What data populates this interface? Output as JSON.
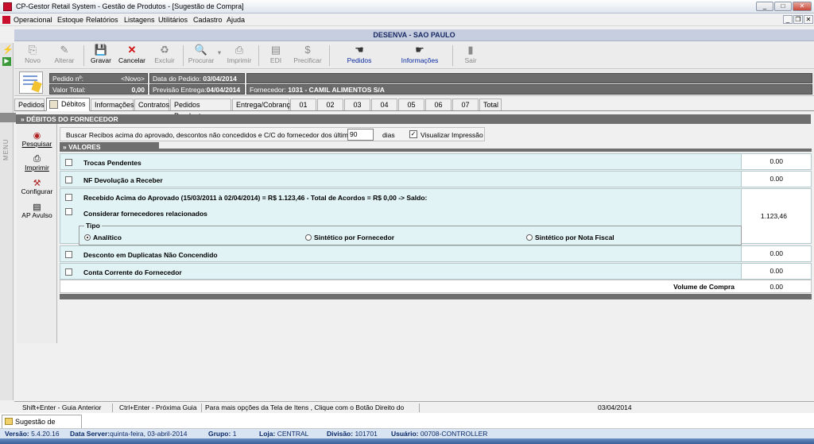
{
  "window": {
    "title": "CP-Gestor Retail System - Gestão de Produtos - [Sugestão de Compra]",
    "controls": {
      "minimize": "_",
      "maximize": "□",
      "close": "✕"
    },
    "mdi_controls": {
      "minimize": "_",
      "restore": "❐",
      "close": "✕"
    }
  },
  "menu": [
    "Operacional",
    "Estoque",
    "Relatórios",
    "Listagens",
    "Utilitários",
    "Cadastro",
    "Ajuda"
  ],
  "side": {
    "label": "MENU"
  },
  "branch": "DESENVA - SAO PAULO",
  "toolbar": {
    "novo": "Novo",
    "alterar": "Alterar",
    "gravar": "Gravar",
    "cancelar": "Cancelar",
    "excluir": "Excluir",
    "procurar": "Procurar",
    "imprimir": "Imprimir",
    "edi": "EDI",
    "precificar": "Precificar",
    "pedidos": "Pedidos",
    "informacoes": "Informações",
    "sair": "Sair",
    "icons": {
      "novo": "new-doc-icon",
      "save": "floppy-icon",
      "cancel": "x-icon"
    }
  },
  "header": {
    "pedido_label": "Pedido nº:",
    "pedido_value": "<Novo>",
    "data_label": "Data do Pedido:",
    "data_value": "03/04/2014",
    "valor_label": "Valor Total:",
    "valor_value": "0,00",
    "previsao_label": "Previsão Entrega:",
    "previsao_value": "04/04/2014",
    "fornecedor_label": "Fornecedor:",
    "fornecedor_value": "1031 - CAMIL ALIMENTOS S/A"
  },
  "tabs": [
    "Pedidos",
    "Débitos",
    "Informações",
    "Contratos",
    "Pedidos Pendentes",
    "Entrega/Cobrança",
    "01",
    "02",
    "03",
    "04",
    "05",
    "06",
    "07",
    "Total"
  ],
  "section": {
    "title": "» DÉBITOS DO FORNECEDOR",
    "values_title": "» VALORES"
  },
  "left_actions": {
    "pesquisar": "Pesquisar",
    "imprimir": "Imprimir",
    "configurar": "Configurar",
    "ap_avulso": "AP Avulso"
  },
  "search": {
    "text": "Buscar Recibos acima do aprovado, descontos não concedidos e C/C do fornecedor dos últimos",
    "days": "90",
    "days_label": "dias",
    "visualizar": "Visualizar Impressão",
    "visualizar_checked": true
  },
  "rows": {
    "trocas": {
      "label": "Trocas Pendentes",
      "value": "0.00"
    },
    "nf": {
      "label": "NF Devolução a Receber",
      "value": "0.00"
    },
    "recebido": {
      "label": "Recebido Acima do Aprovado (15/03/2011 à 02/04/2014) = R$ 1.123,46 - Total de Acordos = R$ 0,00 -> Saldo:",
      "value": "1.123,46"
    },
    "considerar": "Considerar fornecedores relacionados",
    "tipo": "Tipo",
    "radio_analitico": "Analítico",
    "radio_fornecedor": "Sintético por Fornecedor",
    "radio_nota": "Sintético por Nota Fiscal",
    "desconto": {
      "label": "Desconto em Duplicatas Não Concendido",
      "value": "0.00"
    },
    "cc": {
      "label": "Conta Corrente do Fornecedor",
      "value": "0.00"
    },
    "volume": {
      "label": "Volume de Compra",
      "value": "0.00"
    }
  },
  "status": {
    "s1": "Shift+Enter - Guia Anterior",
    "s2": "Ctrl+Enter - Próxima Guia",
    "s3": "Para mais opções da Tela de Itens , Clique com o Botão Direito do Mouse",
    "s4": "03/04/2014"
  },
  "mdi_tab": "Sugestão de Compra",
  "info": {
    "versao_l": "Versão:",
    "versao": "5.4.20.16",
    "server_l": "Data Server:",
    "server": "quinta-feira, 03-abril-2014",
    "grupo_l": "Grupo:",
    "grupo": "1",
    "loja_l": "Loja:",
    "loja": "CENTRAL",
    "divisao_l": "Divisão:",
    "divisao": "101701",
    "usuario_l": "Usuário:",
    "usuario": "00708-CONTROLLER"
  }
}
